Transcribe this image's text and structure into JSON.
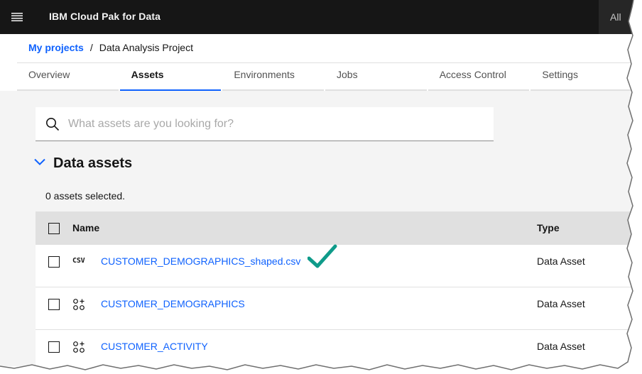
{
  "header": {
    "product_name": "IBM Cloud Pak for Data",
    "scope_label": "All",
    "menu_icon": "hamburger-menu-icon"
  },
  "breadcrumb": {
    "parent": "My projects",
    "separator": "/",
    "current": "Data Analysis Project"
  },
  "tabs": [
    {
      "label": "Overview",
      "active": false
    },
    {
      "label": "Assets",
      "active": true
    },
    {
      "label": "Environments",
      "active": false
    },
    {
      "label": "Jobs",
      "active": false
    },
    {
      "label": "Access Control",
      "active": false
    },
    {
      "label": "Settings",
      "active": false
    }
  ],
  "search": {
    "placeholder": "What assets are you looking for?",
    "value": "",
    "icon": "search-icon"
  },
  "data_assets": {
    "title": "Data assets",
    "selected_text": "0 assets selected.",
    "columns": {
      "name": "Name",
      "type": "Type"
    },
    "rows": [
      {
        "icon": "csv-file-icon",
        "icon_text": "CSV",
        "name": "CUSTOMER_DEMOGRAPHICS_shaped.csv",
        "type": "Data Asset",
        "annotated": true
      },
      {
        "icon": "data-table-icon",
        "name": "CUSTOMER_DEMOGRAPHICS",
        "type": "Data Asset"
      },
      {
        "icon": "data-table-icon",
        "name": "CUSTOMER_ACTIVITY",
        "type": "Data Asset"
      }
    ]
  },
  "colors": {
    "topbar": "#161616",
    "link": "#0f62fe",
    "content_bg": "#f4f4f4",
    "annotation_check": "#0f9b8a"
  }
}
